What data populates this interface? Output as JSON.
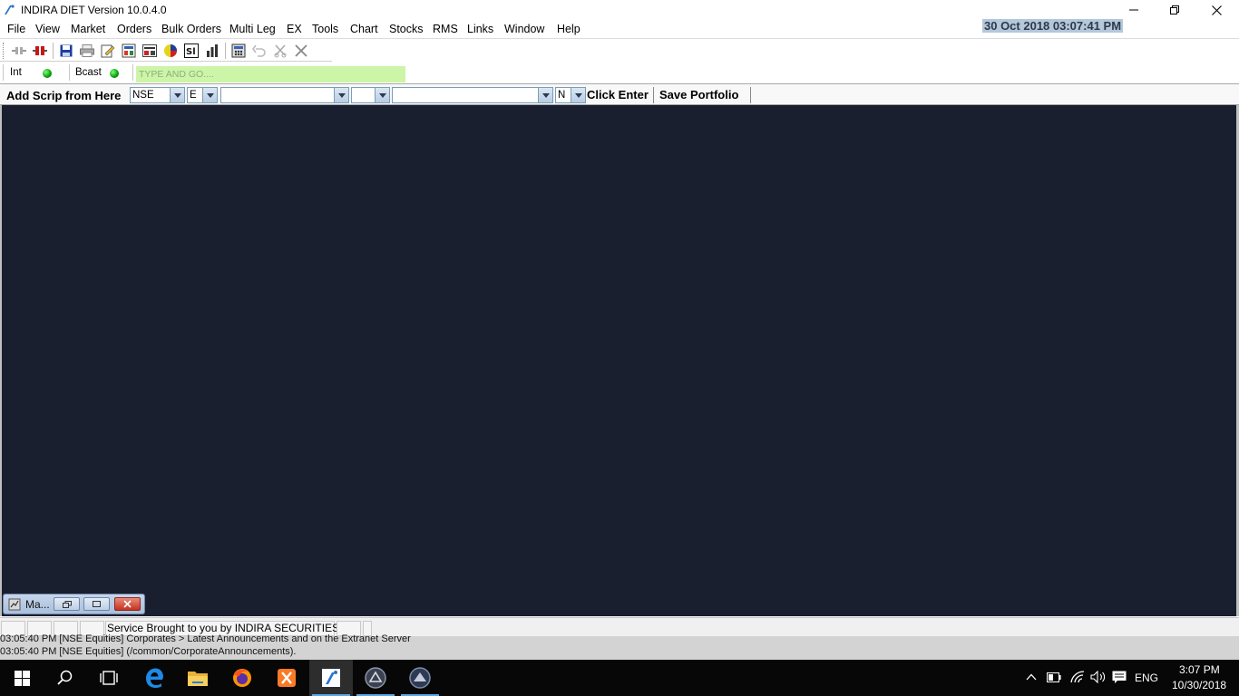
{
  "window": {
    "title": "INDIRA DIET Version 10.0.4.0",
    "clock": "30 Oct 2018  03:07:41 PM"
  },
  "menu": [
    "File",
    "View",
    "Market",
    "Orders",
    "Bulk Orders",
    "Multi Leg",
    "EX",
    "Tools",
    "Chart",
    "Stocks",
    "RMS",
    "Links",
    "Window",
    "Help"
  ],
  "toolbar": {
    "icons": [
      "connect-icon",
      "disconnect-icon",
      "save-icon",
      "print-icon",
      "edit-icon",
      "settings-icon",
      "dashboard-icon",
      "pie-icon",
      "report-icon",
      "chart-icon",
      "calculator-icon",
      "undo-icon",
      "cut-icon",
      "close-icon"
    ]
  },
  "status": {
    "int_label": "Int",
    "bcast_label": "Bcast",
    "type_go_placeholder": "TYPE AND GO...."
  },
  "scrip": {
    "label": "Add Scrip from Here",
    "exchange": "NSE",
    "segment": "E",
    "symbol": "",
    "series": "",
    "expiry": "",
    "type": "N",
    "click_enter": "Click Enter",
    "save_portfolio": "Save Portfolio"
  },
  "minimized_window": {
    "title": "Ma..."
  },
  "statusbar": {
    "service_text": "Service Brought to you by INDIRA SECURITIES"
  },
  "log": [
    "03:05:40 PM [NSE Equities] Corporates > Latest Announcements and on the Extranet Server",
    "03:05:40 PM [NSE Equities] (/common/CorporateAnnouncements)."
  ],
  "taskbar": {
    "language": "ENG",
    "time": "3:07 PM",
    "date": "10/30/2018"
  }
}
